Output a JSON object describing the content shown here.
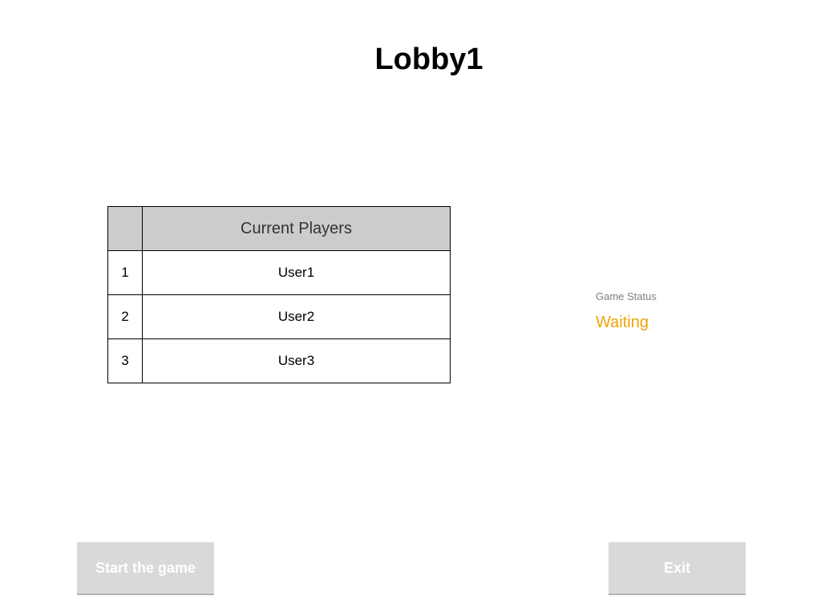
{
  "lobby": {
    "title": "Lobby1"
  },
  "players_table": {
    "header": "Current Players",
    "rows": [
      {
        "index": "1",
        "name": "User1"
      },
      {
        "index": "2",
        "name": "User2"
      },
      {
        "index": "3",
        "name": "User3"
      }
    ]
  },
  "status": {
    "label": "Game Status",
    "value": "Waiting",
    "value_color": "#f0a30a"
  },
  "buttons": {
    "start_label": "Start the game",
    "exit_label": "Exit"
  }
}
